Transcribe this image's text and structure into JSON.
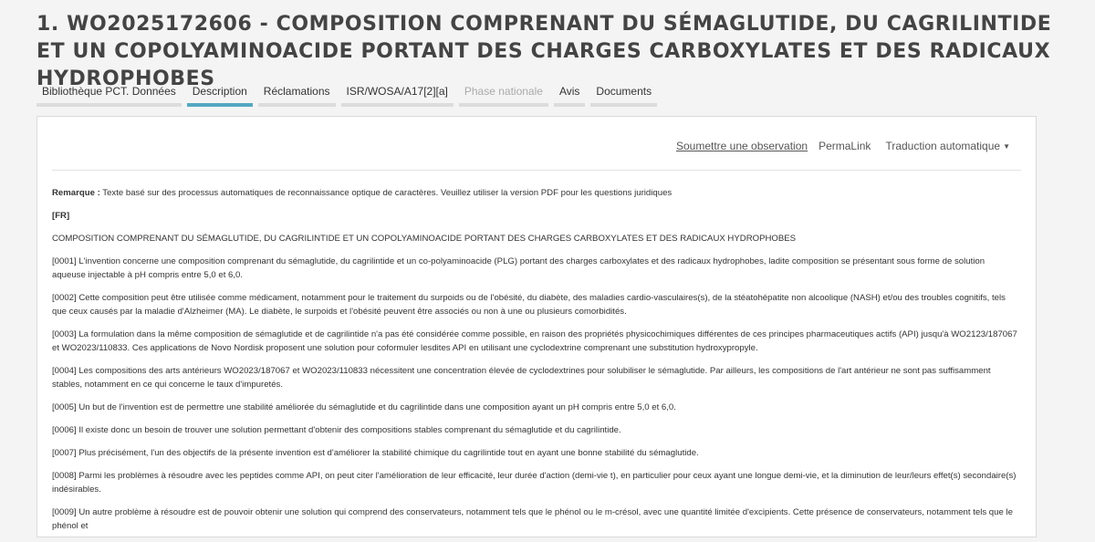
{
  "page_title": "1. WO2025172606 - COMPOSITION COMPRENANT DU SÉMAGLUTIDE, DU CAGRILINTIDE ET UN COPOLYAMINOACIDE PORTANT DES CHARGES CARBOXYLATES ET DES RADICAUX HYDROPHOBES",
  "tabs": [
    {
      "label": "Bibliothèque PCT. Données",
      "state": "normal"
    },
    {
      "label": "Description",
      "state": "active"
    },
    {
      "label": "Réclamations",
      "state": "normal"
    },
    {
      "label": "ISR/WOSA/A17[2][a]",
      "state": "normal"
    },
    {
      "label": "Phase nationale",
      "state": "disabled"
    },
    {
      "label": "Avis",
      "state": "normal"
    },
    {
      "label": "Documents",
      "state": "normal"
    }
  ],
  "toolbar": {
    "observation": "Soumettre une observation",
    "permalink": "PermaLink",
    "translation": "Traduction automatique"
  },
  "remark": {
    "label": "Remarque :",
    "text": " Texte basé sur des processus automatiques de reconnaissance optique de caractères. Veuillez utiliser la version PDF pour les questions juridiques"
  },
  "language": "[FR]",
  "doc_title": "COMPOSITION COMPRENANT DU SÉMAGLUTIDE, DU CAGRILINTIDE ET UN COPOLYAMINOACIDE PORTANT DES CHARGES CARBOXYLATES ET DES RADICAUX HYDROPHOBES",
  "paragraphs": [
    "[0001] L'invention concerne une composition comprenant du sémaglutide, du cagrilintide et un co-polyaminoacide (PLG) portant des charges carboxylates et des radicaux hydrophobes, ladite composition se présentant sous forme de solution aqueuse injectable à pH compris entre 5,0 et 6,0.",
    "[0002] Cette composition peut être utilisée comme médicament, notamment pour le traitement du surpoids ou de l'obésité, du diabète, des maladies cardio-vasculaires(s), de la stéatohépatite non alcoolique (NASH) et/ou des troubles cognitifs, tels que ceux causés par la maladie d'Alzheimer (MA). Le diabète, le surpoids et l'obésité peuvent être associés ou non à une ou plusieurs comorbidités.",
    "[0003] La formulation dans la même composition de sémaglutide et de cagrilintide n'a pas été considérée comme possible, en raison des propriétés physicochimiques différentes de ces principes pharmaceutiques actifs (API) jusqu'à WO2123/187067 et WO2023/110833. Ces applications de Novo Nordisk proposent une solution pour coformuler lesdites API en utilisant une cyclodextrine comprenant une substitution hydroxypropyle.",
    "[0004] Les compositions des arts antérieurs WO2023/187067 et WO2023/110833 nécessitent une concentration élevée de cyclodextrines pour solubiliser le sémaglutide. Par ailleurs, les compositions de l'art antérieur ne sont pas suffisamment stables, notamment en ce qui concerne le taux d'impuretés.",
    "[0005] Un but de l'invention est de permettre une stabilité améliorée du sémaglutide et du cagrilintide dans une composition ayant un pH compris entre 5,0 et 6,0.",
    "[0006] Il existe donc un besoin de trouver une solution permettant d'obtenir des compositions stables comprenant du sémaglutide et du cagrilintide.",
    "[0007] Plus précisément, l'un des objectifs de la présente invention est d'améliorer la stabilité chimique du cagrilintide tout en ayant une bonne stabilité du sémaglutide.",
    "[0008] Parmi les problèmes à résoudre avec les peptides comme API, on peut citer l'amélioration de leur efficacité, leur durée d'action (demi-vie t), en particulier pour ceux ayant une longue demi-vie, et la diminution de leur/leurs effet(s) secondaire(s) indésirables.",
    "[0009] Un autre problème à résoudre est de pouvoir obtenir une solution qui comprend des conservateurs, notamment tels que le phénol ou le m-crésol, avec une quantité limitée d'excipients. Cette présence de conservateurs, notamment tels que le phénol et"
  ]
}
